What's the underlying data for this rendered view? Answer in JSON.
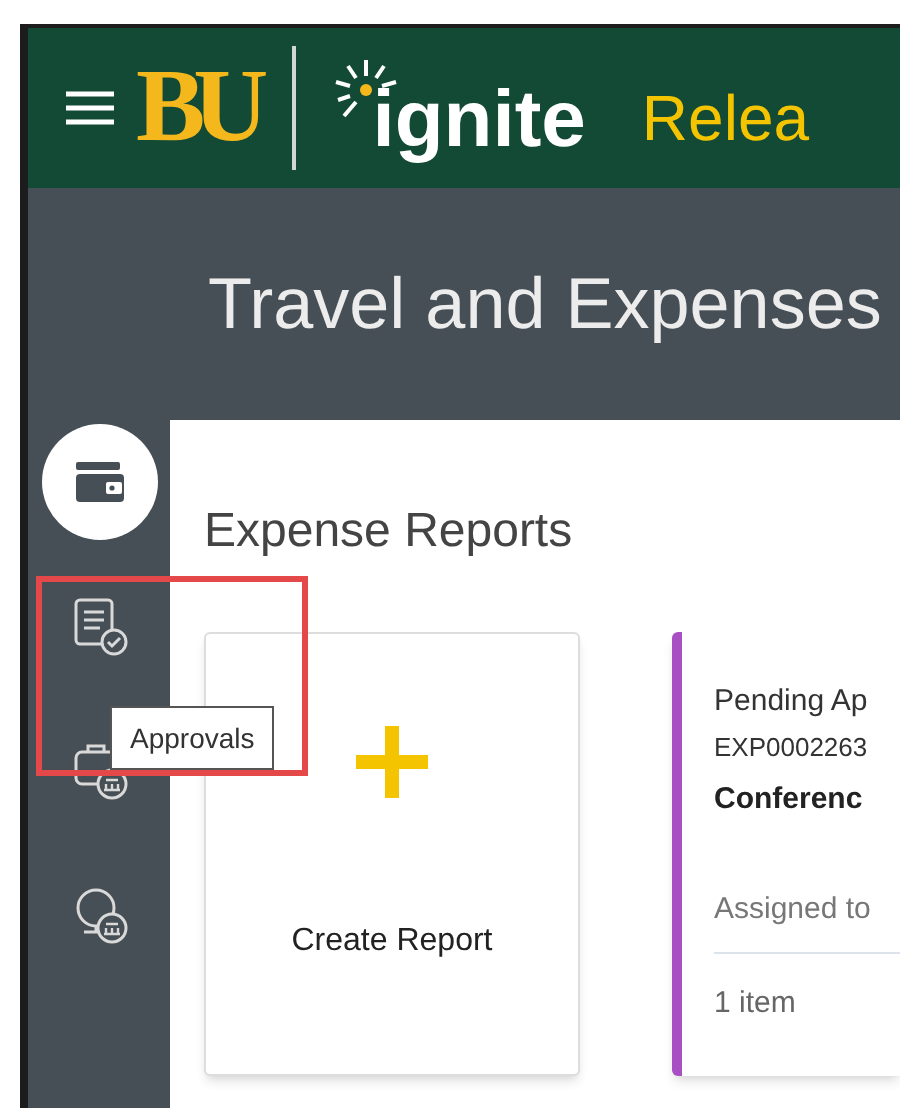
{
  "header": {
    "logo": "BU",
    "brand": "ignite",
    "title": "Relea"
  },
  "banner": {
    "title": "Travel and Expenses"
  },
  "sidebar": {
    "items": [
      {
        "kind": "wallet",
        "selected": true
      },
      {
        "kind": "approvals",
        "selected": false
      },
      {
        "kind": "travel",
        "selected": false
      },
      {
        "kind": "globe",
        "selected": false
      }
    ]
  },
  "tooltip": "Approvals",
  "content": {
    "title": "Expense Reports",
    "create_card": {
      "label": "Create Report"
    },
    "report_card": {
      "status": "Pending Ap",
      "number": "EXP0002263",
      "name": "Conferenc",
      "assigned": "Assigned to",
      "count": "1 item",
      "color": "#a94fc4"
    }
  }
}
